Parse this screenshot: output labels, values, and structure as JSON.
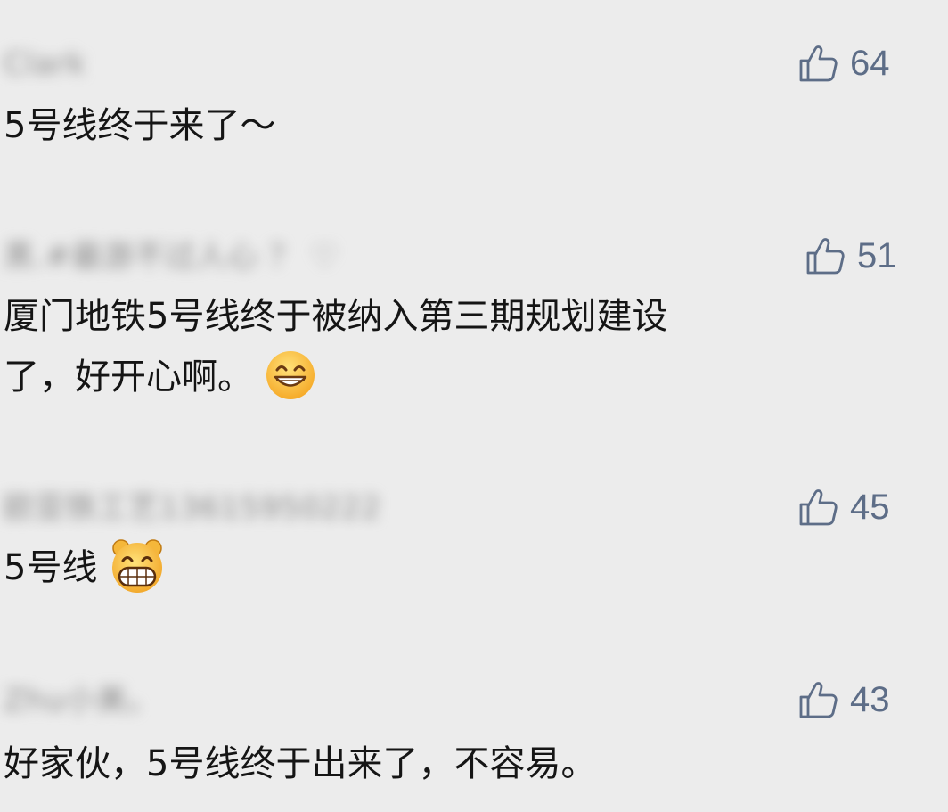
{
  "comments": [
    {
      "username": "Clark",
      "likes": "64",
      "text": "5号线终于来了～"
    },
    {
      "username": "黑.#最游不过人心 ？ ♡",
      "likes": "51",
      "line1": "厦门地铁5号线终于被纳入第三期规划建设",
      "line2": "了，好开心啊。",
      "emoji": "grinning-face-with-smiling-eyes"
    },
    {
      "username": "欧亚铁工艺13615950222",
      "likes": "45",
      "text": "5号线",
      "emoji": "grinning-bear-face"
    },
    {
      "username": "Zhu小美。",
      "likes": "43",
      "text": "好家伙，5号线终于出来了，不容易。"
    }
  ],
  "colors": {
    "background": "#ececec",
    "text": "#151515",
    "like_accent": "#5d6d87",
    "username_blurred": "#8a8a8a"
  },
  "icons": {
    "like": "thumbs-up-icon"
  }
}
